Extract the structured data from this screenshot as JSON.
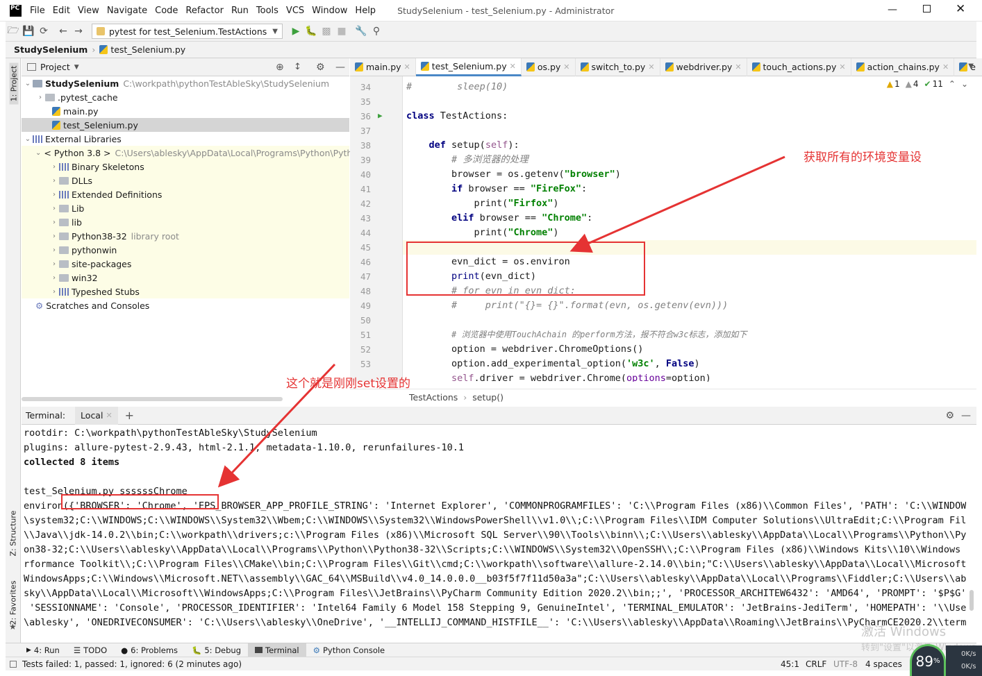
{
  "window": {
    "title": "StudySelenium - test_Selenium.py - Administrator",
    "menu": [
      "File",
      "Edit",
      "View",
      "Navigate",
      "Code",
      "Refactor",
      "Run",
      "Tools",
      "VCS",
      "Window",
      "Help"
    ]
  },
  "toolbar": {
    "run_config": "pytest for test_Selenium.TestActions"
  },
  "navbar": {
    "project": "StudySelenium",
    "file": "test_Selenium.py"
  },
  "left_strip": {
    "project": "1: Project",
    "structure": "Z: Structure",
    "favorites": "2: Favorites"
  },
  "project_panel": {
    "header": "Project",
    "tree": {
      "root": "StudySelenium",
      "root_path": "C:\\workpath\\pythonTestAbleSky\\StudySelenium",
      "pytest_cache": ".pytest_cache",
      "main_py": "main.py",
      "test_selenium_py": "test_Selenium.py",
      "external_libraries": "External Libraries",
      "python_sdk": "< Python 3.8 >",
      "python_sdk_path": "C:\\Users\\ablesky\\AppData\\Local\\Programs\\Python\\Pyth",
      "binary_skeletons": "Binary Skeletons",
      "dlls": "DLLs",
      "extended_definitions": "Extended Definitions",
      "lib_upper": "Lib",
      "lib_lower": "lib",
      "python38": "Python38-32",
      "library_root": "library root",
      "pythonwin": "pythonwin",
      "site_packages": "site-packages",
      "win32": "win32",
      "typeshed_stubs": "Typeshed Stubs",
      "scratches": "Scratches and Consoles"
    }
  },
  "editor": {
    "tabs": [
      "main.py",
      "test_Selenium.py",
      "os.py",
      "switch_to.py",
      "webdriver.py",
      "touch_actions.py",
      "action_chains.py",
      "e"
    ],
    "active_tab": "test_Selenium.py",
    "inspections": {
      "warnings": "1",
      "weak": "4",
      "ok": "11"
    },
    "line_numbers": [
      "34",
      "35",
      "36",
      "37",
      "38",
      "39",
      "40",
      "41",
      "42",
      "43",
      "44",
      "45",
      "46",
      "47",
      "48",
      "49",
      "50",
      "51",
      "52",
      "53"
    ],
    "breadcrumb": [
      "TestActions",
      "setup()"
    ]
  },
  "terminal": {
    "label": "Terminal:",
    "tab": "Local",
    "lines": [
      "rootdir: C:\\workpath\\pythonTestAbleSky\\StudySelenium",
      "plugins: allure-pytest-2.9.43, html-2.1.1, metadata-1.10.0, rerunfailures-10.1",
      "collected 8 items",
      "",
      "test_Selenium.py ssssssChrome",
      "environ({'BROWSER': 'Chrome', 'EPS_BROWSER_APP_PROFILE_STRING': 'Internet Explorer', 'COMMONPROGRAMFILES': 'C:\\\\Program Files (x86)\\\\Common Files', 'PATH': 'C:\\\\WINDOWS\\",
      "\\system32;C:\\\\WINDOWS;C:\\\\WINDOWS\\\\System32\\\\Wbem;C:\\\\WINDOWS\\\\System32\\\\WindowsPowerShell\\\\v1.0\\\\;C:\\\\Program Files\\\\IDM Computer Solutions\\\\UltraEdit;C:\\\\Program Files",
      "\\\\Java\\\\jdk-14.0.2\\\\bin;C:\\\\workpath\\\\drivers;c:\\\\Program Files (x86)\\\\Microsoft SQL Server\\\\90\\\\Tools\\\\binn\\\\;C:\\\\Users\\\\ablesky\\\\AppData\\\\Local\\\\Programs\\\\Python\\\\Pyth",
      "on38-32;C:\\\\Users\\\\ablesky\\\\AppData\\\\Local\\\\Programs\\\\Python\\\\Python38-32\\\\Scripts;C:\\\\WINDOWS\\\\System32\\\\OpenSSH\\\\;C:\\\\Program Files (x86)\\\\Windows Kits\\\\10\\\\Windows Pe",
      "rformance Toolkit\\\\;C:\\\\Program Files\\\\CMake\\\\bin;C:\\\\Program Files\\\\Git\\\\cmd;C:\\\\workpath\\\\software\\\\allure-2.14.0\\\\bin;\"C:\\\\Users\\\\ablesky\\\\AppData\\\\Local\\\\Microsoft\\\\",
      "WindowsApps;C:\\\\Windows\\\\Microsoft.NET\\\\assembly\\\\GAC_64\\\\MSBuild\\\\v4.0_14.0.0.0__b03f5f7f11d50a3a\";C:\\\\Users\\\\ablesky\\\\AppData\\\\Local\\\\Programs\\\\Fiddler;C:\\\\Users\\\\able",
      "sky\\\\AppData\\\\Local\\\\Microsoft\\\\WindowsApps;C:\\\\Program Files\\\\JetBrains\\\\PyCharm Community Edition 2020.2\\\\bin;;', 'PROCESSOR_ARCHITEW6432': 'AMD64', 'PROMPT': '$P$G',",
      " 'SESSIONNAME': 'Console', 'PROCESSOR_IDENTIFIER': 'Intel64 Family 6 Model 158 Stepping 9, GenuineIntel', 'TERMINAL_EMULATOR': 'JetBrains-JediTerm', 'HOMEPATH': '\\\\Users\\",
      "\\ablesky', 'ONEDRIVECONSUMER': 'C:\\\\Users\\\\ablesky\\\\OneDrive', '__INTELLIJ_COMMAND_HISTFILE__': 'C:\\\\Users\\\\ablesky\\\\AppData\\\\Roaming\\\\JetBrains\\\\PyCharmCE2020.2\\\\termin"
    ]
  },
  "bottom_tools": {
    "run": "4: Run",
    "todo": "TODO",
    "problems": "6: Problems",
    "debug": "5: Debug",
    "terminal": "Terminal",
    "console": "Python Console"
  },
  "status": {
    "message": "Tests failed: 1, passed: 1, ignored: 6 (2 minutes ago)",
    "position": "45:1",
    "line_sep": "CRLF",
    "encoding": "UTF-8",
    "indent": "4 spaces",
    "cpu": "89",
    "cpu_unit": "%",
    "net_up": "0K/s",
    "net_down": "0K/s"
  },
  "watermark": {
    "line1": "激活 Windows",
    "line2": "转到\"设置\"以激活 Windows。"
  },
  "annotations": {
    "env_note": "获取所有的环境变量设",
    "set_note": "这个就是刚刚set设置的"
  },
  "colors": {
    "annotation": "#e53333",
    "active_tab": "#4a88c7",
    "keyword": "#000080",
    "string": "#008000"
  }
}
